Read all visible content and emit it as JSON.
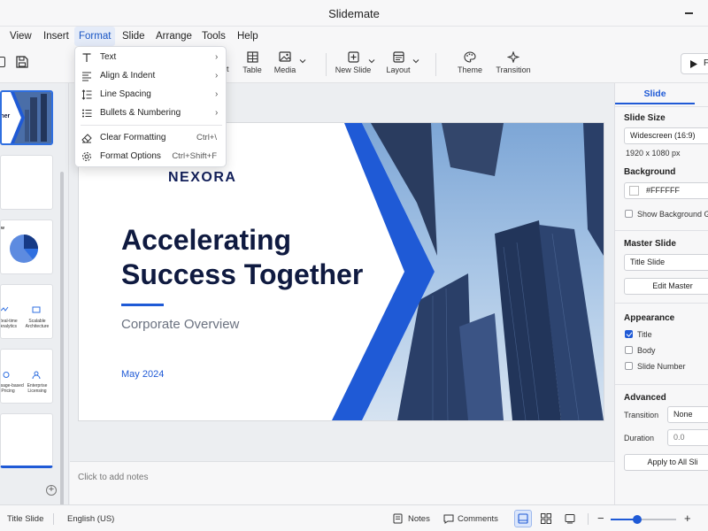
{
  "app": {
    "title": "Slidemate"
  },
  "menu": [
    "View",
    "Insert",
    "Format",
    "Slide",
    "Arrange",
    "Tools",
    "Help"
  ],
  "toolbar": {
    "table": "Table",
    "media": "Media",
    "new_slide": "New Slide",
    "layout": "Layout",
    "theme": "Theme",
    "transition": "Transition",
    "partial_t": "t",
    "present_partial": "F"
  },
  "format_menu": {
    "items": [
      {
        "label": "Text",
        "submenu": true,
        "icon": "text-icon"
      },
      {
        "label": "Align & Indent",
        "submenu": true,
        "icon": "align-icon"
      },
      {
        "label": "Line Spacing",
        "submenu": true,
        "icon": "line-spacing-icon"
      },
      {
        "label": "Bullets & Numbering",
        "submenu": true,
        "icon": "bullets-icon"
      },
      {
        "label": "Clear Formatting",
        "shortcut": "Ctrl+\\",
        "icon": "eraser-icon"
      },
      {
        "label": "Format Options",
        "shortcut": "Ctrl+Shift+F",
        "icon": "gear-icon"
      }
    ]
  },
  "thumbs": {
    "t1_text": "ther",
    "t3_text": "w",
    "t4_a": "Real-time\nAnalytics",
    "t4_b": "Scalable\nArchitecture",
    "t5_a": "Usage-based\nPricing",
    "t5_b": "Enterprise\nLicensing"
  },
  "slide": {
    "logo": "NEXORA",
    "headline": "Accelerating Success Together",
    "subtitle": "Corporate Overview",
    "date": "May 2024"
  },
  "notes": {
    "placeholder": "Click to add notes"
  },
  "right_panel": {
    "tab": "Slide",
    "slide_size_label": "Slide Size",
    "slide_size_value": "Widescreen (16:9)",
    "dims": "1920 x 1080 px",
    "background_label": "Background",
    "background_value": "#FFFFFF",
    "show_bg_graphics": "Show Background Gra",
    "master_slide_label": "Master Slide",
    "master_slide_value": "Title Slide",
    "edit_master": "Edit Master",
    "appearance_label": "Appearance",
    "appearance_items": [
      {
        "label": "Title",
        "checked": true
      },
      {
        "label": "Body",
        "checked": false
      },
      {
        "label": "Slide Number",
        "checked": false
      }
    ],
    "advanced_label": "Advanced",
    "transition_label": "Transition",
    "transition_value": "None",
    "duration_label": "Duration",
    "duration_value": "0.0",
    "apply_all": "Apply to All Sli"
  },
  "status": {
    "layout_name": "Title Slide",
    "language": "English (US)",
    "notes": "Notes",
    "comments": "Comments",
    "zoom_level": 0.4
  },
  "colors": {
    "accent": "#1f5ad6",
    "navy": "#0f1a40"
  }
}
